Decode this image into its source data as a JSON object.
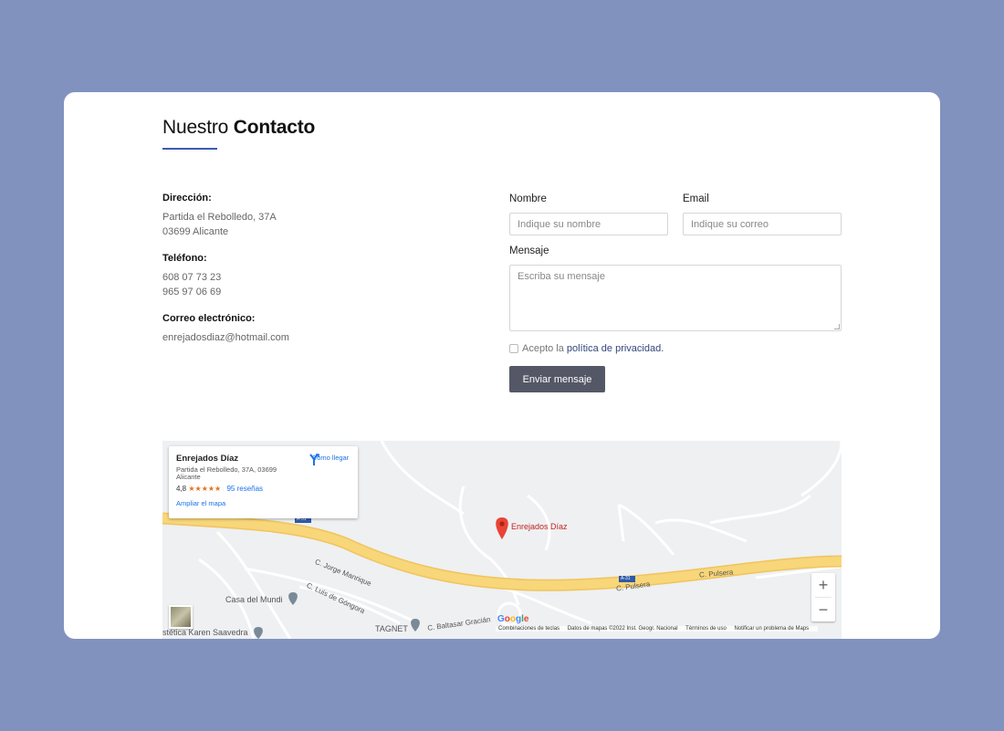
{
  "header": {
    "title_regular": "Nuestro",
    "title_bold": "Contacto"
  },
  "contact": {
    "address_label": "Dirección:",
    "address_line1": "Partida el Rebolledo, 37A",
    "address_line2": "03699 Alicante",
    "phone_label": "Teléfono:",
    "phone1": "608 07 73 23",
    "phone2": "965 97 06 69",
    "email_label": "Correo electrónico:",
    "email": "enrejadosdiaz@hotmail.com"
  },
  "form": {
    "name_label": "Nombre",
    "name_placeholder": "Indique su nombre",
    "email_label": "Email",
    "email_placeholder": "Indique su correo",
    "message_label": "Mensaje",
    "message_placeholder": "Escriba su mensaje",
    "privacy_prefix": "Acepto la",
    "privacy_link": "política de privacidad.",
    "submit_label": "Enviar mensaje"
  },
  "map": {
    "place_name": "Enrejados Díaz",
    "place_address": "Partida el Rebolledo, 37A, 03699 Alicante",
    "rating": "4,8",
    "stars": "★★★★★",
    "reviews": "95 reseñas",
    "directions": "Cómo llegar",
    "enlarge": "Ampliar el mapa",
    "pin_label": "Enrejados Díaz",
    "zoom_in": "+",
    "zoom_out": "−",
    "labels": {
      "highway_a31_top": "A-31",
      "highway_a31_right": "A-31",
      "jorge_manrique": "C. Jorge Manrique",
      "luis_gongora": "C. Luis de Góngora",
      "pulsera1": "C. Pulsera",
      "pulsera2": "C. Pulsera",
      "casa_mundi": "Casa del Mundi",
      "tagnet": "TAGNET",
      "baltasar": "C. Baltasar Gracián",
      "karen": "stética Karen Saavedra"
    },
    "attribution": {
      "google": "Google",
      "shortcuts": "Combinaciones de teclas",
      "data": "Datos de mapas ©2022 Inst. Geogr. Nacional",
      "terms": "Términos de uso",
      "report": "Notificar un problema de Maps"
    },
    "colors": {
      "highway": "#f8d67a",
      "road": "#ffffff",
      "background": "#eef0f2",
      "pin": "#ea4335"
    }
  }
}
